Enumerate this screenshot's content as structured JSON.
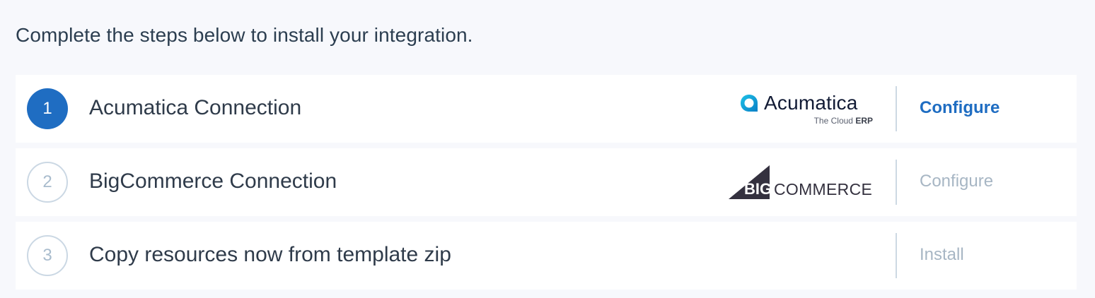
{
  "intro_text": "Complete the steps below to install your integration.",
  "steps": [
    {
      "number": "1",
      "title": "Acumatica Connection",
      "logo": {
        "icon": "acumatica-logo-icon",
        "wordmark": "Acumatica",
        "tagline_prefix": "The Cloud",
        "tagline_bold": "ERP"
      },
      "action_label": "Configure",
      "state": "active"
    },
    {
      "number": "2",
      "title": "BigCommerce Connection",
      "logo": {
        "icon": "bigcommerce-logo-icon",
        "part1": "BIG",
        "part2": "COMMERCE"
      },
      "action_label": "Configure",
      "state": "inactive"
    },
    {
      "number": "3",
      "title": "Copy resources now from template zip",
      "action_label": "Install",
      "state": "inactive"
    }
  ],
  "colors": {
    "background": "#f7f8fc",
    "card": "#ffffff",
    "accent": "#1f6dc2",
    "inactive_text": "#a7b6c4",
    "divider": "#cdd9e3"
  }
}
